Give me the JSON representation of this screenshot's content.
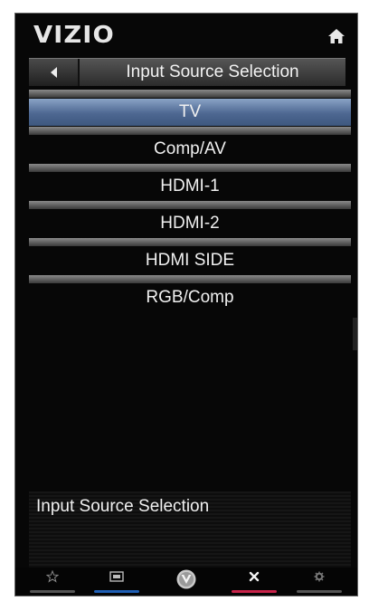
{
  "header": {
    "logo": "VIZIO",
    "home_icon": "home-icon"
  },
  "titlebar": {
    "title": "Input Source Selection",
    "back_icon": "back-arrow-icon"
  },
  "menu": {
    "items": [
      {
        "label": "TV",
        "selected": true
      },
      {
        "label": "Comp/AV",
        "selected": false
      },
      {
        "label": "HDMI-1",
        "selected": false
      },
      {
        "label": "HDMI-2",
        "selected": false
      },
      {
        "label": "HDMI SIDE",
        "selected": false
      },
      {
        "label": "RGB/Comp",
        "selected": false
      }
    ]
  },
  "description": {
    "text": "Input Source Selection"
  },
  "bottom_bar": {
    "buttons": [
      {
        "icon": "star-icon",
        "color": "#555555"
      },
      {
        "icon": "widget-icon",
        "color": "#1f5fb5"
      },
      {
        "icon": "vizio-v-icon",
        "color": null
      },
      {
        "icon": "close-icon",
        "color": "#c8234a"
      },
      {
        "icon": "gear-icon",
        "color": "#555555"
      }
    ]
  },
  "colors": {
    "selected_bg": "#4d6791",
    "background": "#070707"
  }
}
